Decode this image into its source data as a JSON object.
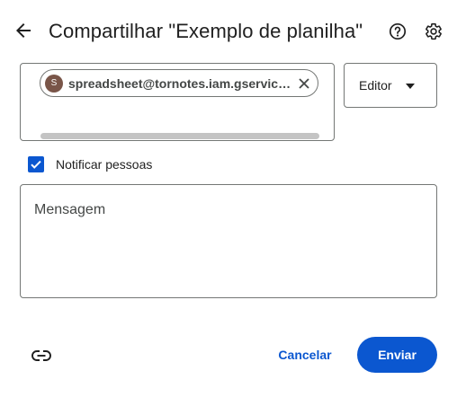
{
  "header": {
    "title": "Compartilhar \"Exemplo de planilha\"",
    "back_icon": "arrow-back-icon",
    "help_icon": "help-circle-icon",
    "settings_icon": "gear-icon"
  },
  "recipients": {
    "chips": [
      {
        "avatar_initial": "S",
        "label": "spreadsheet@tornotes.iam.gserviceaccount.com",
        "avatar_color": "#795548"
      }
    ],
    "remove_icon": "close-icon"
  },
  "role": {
    "selected": "Editor",
    "arrow_icon": "caret-down-icon"
  },
  "notify": {
    "label": "Notificar pessoas",
    "checked": true
  },
  "message": {
    "placeholder": "Mensagem",
    "value": ""
  },
  "footer": {
    "link_icon": "link-icon",
    "cancel_label": "Cancelar",
    "send_label": "Enviar"
  },
  "colors": {
    "accent": "#0b57d0",
    "border": "#747775",
    "text": "#1f1f1f"
  }
}
